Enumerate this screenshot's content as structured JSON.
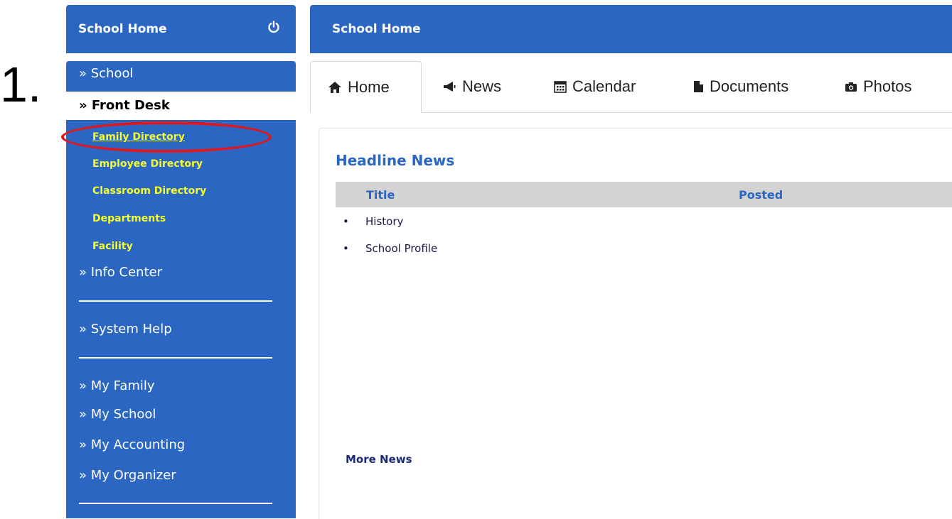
{
  "annotation": {
    "step": "1."
  },
  "sidebar": {
    "header_title": "School Home",
    "items": [
      {
        "label": "» School"
      },
      {
        "label": "» Front Desk"
      },
      {
        "label": "» Info Center"
      },
      {
        "label": "» System Help"
      },
      {
        "label": "» My Family"
      },
      {
        "label": "» My School"
      },
      {
        "label": "» My Accounting"
      },
      {
        "label": "» My Organizer"
      }
    ],
    "subitems": [
      {
        "label": "Family Directory"
      },
      {
        "label": "Employee Directory"
      },
      {
        "label": "Classroom Directory"
      },
      {
        "label": "Departments"
      },
      {
        "label": "Facility"
      }
    ],
    "highlight_color": "#e0181d",
    "sub_color": "#f4ff2a"
  },
  "main": {
    "header_title": "School Home",
    "tabs": [
      {
        "label": "Home",
        "icon": "home-icon"
      },
      {
        "label": "News",
        "icon": "megaphone-icon"
      },
      {
        "label": "Calendar",
        "icon": "calendar-icon"
      },
      {
        "label": "Documents",
        "icon": "document-icon"
      },
      {
        "label": "Photos",
        "icon": "camera-icon"
      }
    ],
    "headline": "Headline News",
    "columns": [
      "Title",
      "Posted"
    ],
    "news": [
      "History",
      "School Profile"
    ],
    "bullet": "•",
    "more": "More News"
  },
  "colors": {
    "brand": "#2a66c2"
  }
}
